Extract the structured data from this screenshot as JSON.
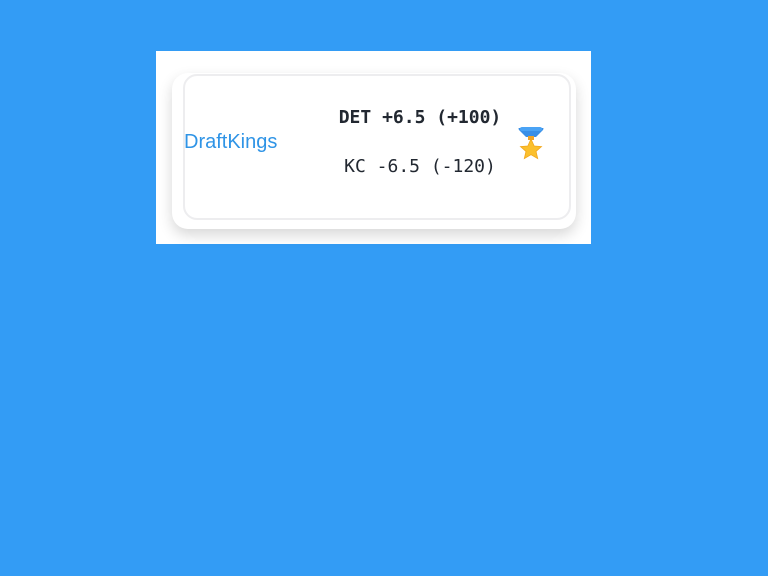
{
  "odds_card": {
    "sportsbook": "DraftKings",
    "line_away": "DET +6.5 (+100)",
    "line_home": "KC -6.5 (-120)",
    "badge_icon": "medal-icon"
  },
  "colors": {
    "background": "#339cf5",
    "sportsbook_link": "#2f94e6",
    "medal_ribbon": "#3a8fe6",
    "medal_star": "#fbc02d"
  }
}
